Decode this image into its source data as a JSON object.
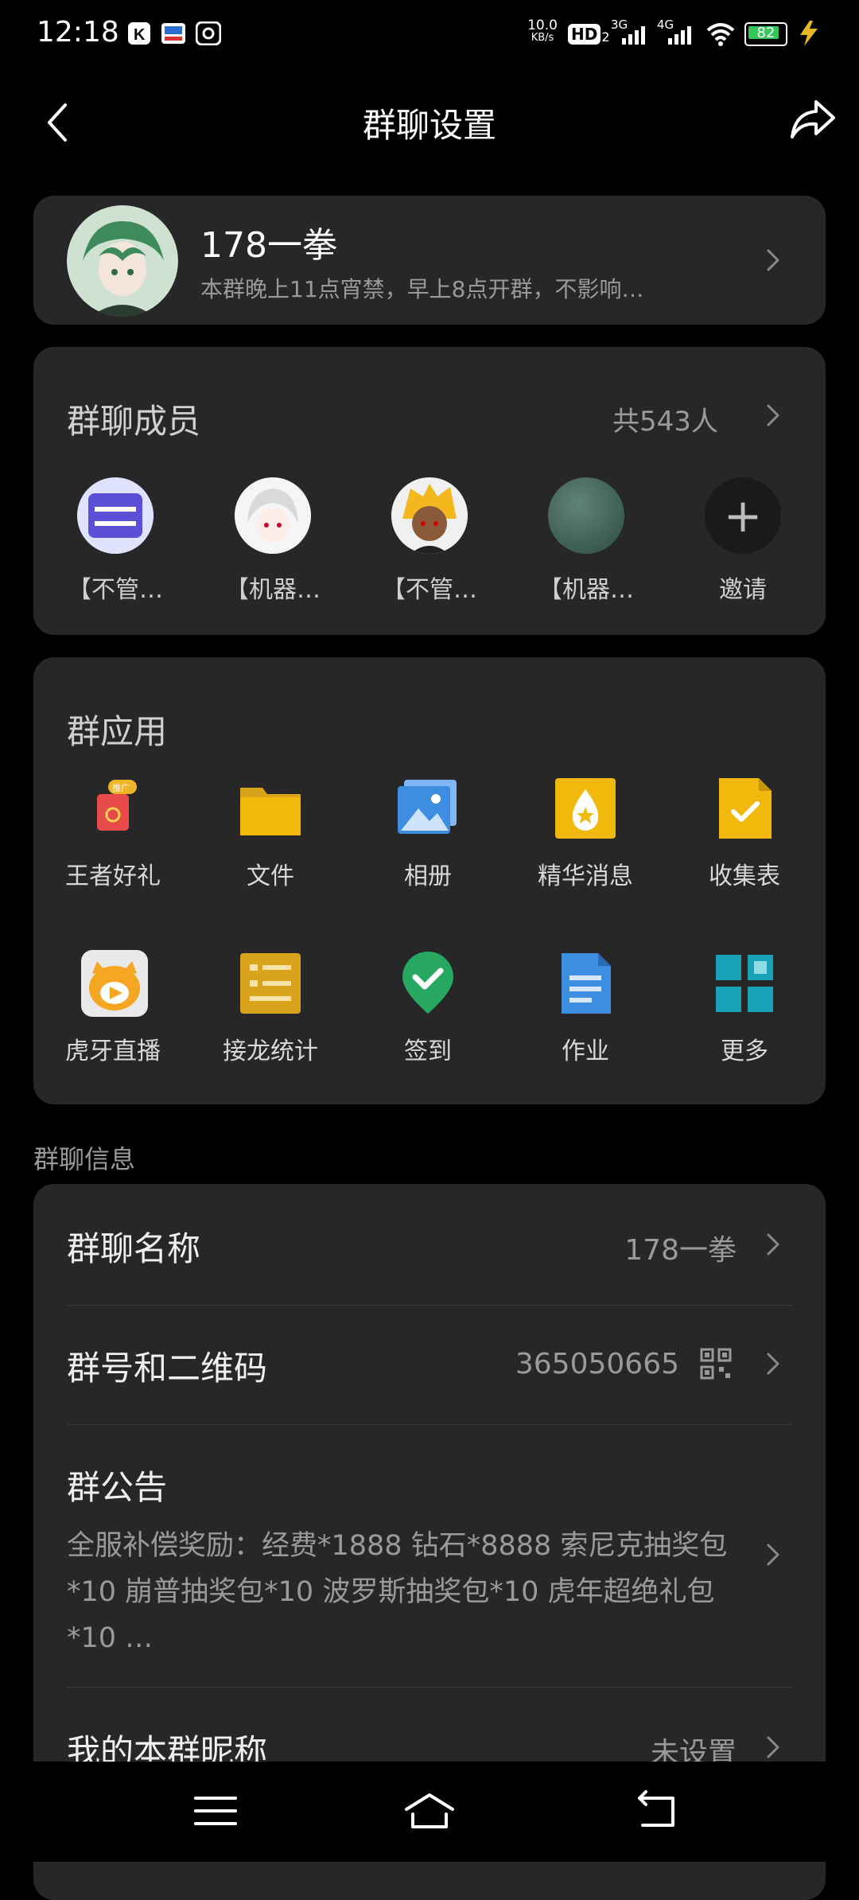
{
  "status_bar": {
    "time": "12:18",
    "net_speed_value": "10.0",
    "net_speed_unit": "KB/s",
    "hd": "HD",
    "hd_sub": "2",
    "signal1": "3G",
    "signal2": "4G",
    "battery": "82",
    "icons": [
      "k-app-icon",
      "news-app-icon",
      "gallery-app-icon",
      "wifi-icon",
      "charging-icon"
    ]
  },
  "header": {
    "title": "群聊设置",
    "back_icon": "chevron-left-icon",
    "share_icon": "share-icon"
  },
  "group": {
    "name": "178一拳",
    "description": "本群晚上11点宵禁，早上8点开群，不影响…"
  },
  "members": {
    "title": "群聊成员",
    "count": "共543人",
    "items": [
      {
        "label": "【不管…"
      },
      {
        "label": "【机器…"
      },
      {
        "label": "【不管…"
      },
      {
        "label": "【机器…"
      }
    ],
    "invite_label": "邀请",
    "invite_symbol": "+"
  },
  "apps": {
    "title": "群应用",
    "items": [
      {
        "label": "王者好礼",
        "icon": "gift-icon",
        "badge": "推广"
      },
      {
        "label": "文件",
        "icon": "folder-icon"
      },
      {
        "label": "相册",
        "icon": "photo-album-icon"
      },
      {
        "label": "精华消息",
        "icon": "essence-icon"
      },
      {
        "label": "收集表",
        "icon": "form-icon"
      },
      {
        "label": "虎牙直播",
        "icon": "huya-live-icon"
      },
      {
        "label": "接龙统计",
        "icon": "list-stats-icon"
      },
      {
        "label": "签到",
        "icon": "check-in-icon"
      },
      {
        "label": "作业",
        "icon": "homework-icon"
      },
      {
        "label": "更多",
        "icon": "more-grid-icon"
      }
    ]
  },
  "info": {
    "section_title": "群聊信息",
    "name_label": "群聊名称",
    "name_value": "178一拳",
    "number_label": "群号和二维码",
    "number_value": "365050665",
    "notice_label": "群公告",
    "notice_text": "全服补偿奖励：经费*1888 钻石*8888 索尼克抽奖包*10  崩普抽奖包*10  波罗斯抽奖包*10 虎年超绝礼包*10 …",
    "nickname_label": "我的本群昵称",
    "nickname_value": "未设置"
  },
  "colors": {
    "background": "#000000",
    "card": "#272727",
    "secondary_text": "#9a9a9a",
    "accent_yellow": "#e8b923",
    "accent_blue": "#3d8ee0",
    "accent_green": "#27a860",
    "accent_teal": "#1aa3b8"
  }
}
